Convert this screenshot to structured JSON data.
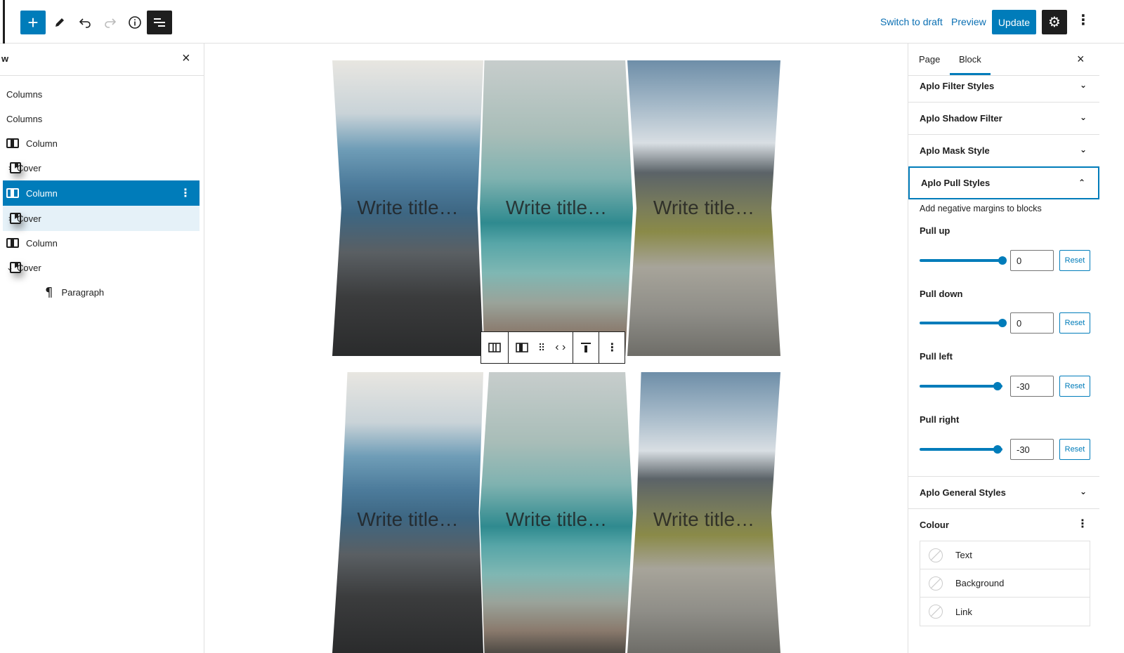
{
  "topbar": {
    "switch_draft": "Switch to draft",
    "preview": "Preview",
    "update": "Update",
    "icons": [
      "plus-icon",
      "pencil-icon",
      "undo-icon",
      "redo-icon",
      "info-icon",
      "list-view-icon",
      "gear-icon",
      "more-vertical-icon"
    ]
  },
  "listview": {
    "title": "w",
    "items": [
      {
        "label": "Columns"
      },
      {
        "label": "Columns"
      },
      {
        "label": "Column"
      },
      {
        "label": "Cover"
      },
      {
        "label": "Column"
      },
      {
        "label": "Cover"
      },
      {
        "label": "Column"
      },
      {
        "label": "Cover"
      },
      {
        "label": "Paragraph"
      }
    ]
  },
  "canvas": {
    "cover_title": "Write title…"
  },
  "sidebar": {
    "tabs": [
      "Page",
      "Block"
    ],
    "panels": {
      "filter": "Aplo Filter Styles",
      "shadow": "Aplo Shadow Filter",
      "mask": "Aplo Mask Style",
      "pull": "Aplo Pull Styles",
      "general": "Aplo General Styles"
    },
    "pull_help": "Add negative margins to blocks",
    "controls": [
      {
        "label": "Pull up",
        "value": "0",
        "reset": "Reset",
        "level": 1.0
      },
      {
        "label": "Pull down",
        "value": "0",
        "reset": "Reset",
        "level": 1.0
      },
      {
        "label": "Pull left",
        "value": "-30",
        "reset": "Reset",
        "level": 0.94
      },
      {
        "label": "Pull right",
        "value": "-30",
        "reset": "Reset",
        "level": 0.94
      }
    ],
    "colour": {
      "title": "Colour",
      "items": [
        "Text",
        "Background",
        "Link"
      ]
    }
  },
  "colors": {
    "accent": "#007cba",
    "dark": "#1e1e1e"
  }
}
